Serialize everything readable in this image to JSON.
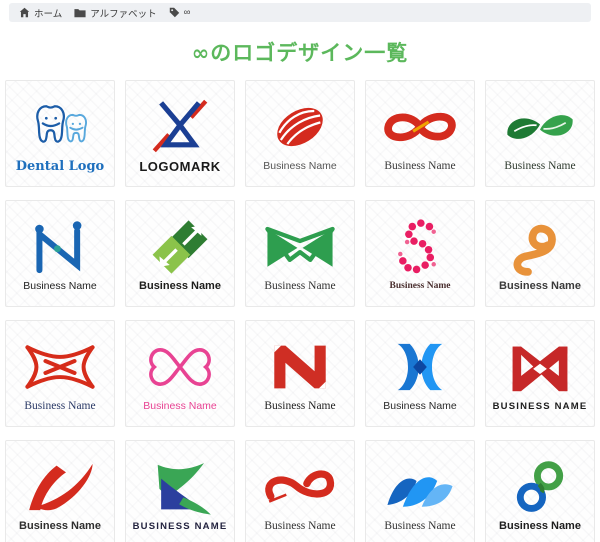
{
  "breadcrumb": {
    "items": [
      {
        "icon": "home-icon",
        "label": "ホーム"
      },
      {
        "icon": "folder-icon",
        "label": "アルファベット"
      },
      {
        "icon": "tag-icon",
        "label": "∞"
      }
    ]
  },
  "header": {
    "title": "∞のロゴデザイン一覧",
    "title_color": "#5cb85c"
  },
  "gallery": {
    "columns": 5,
    "rows": 4,
    "cards": [
      {
        "name": "Dental Logo",
        "icon": "dental-teeth-logo-icon",
        "text_color": "#1e6fbd",
        "logo_colors": [
          "#1c5da8",
          "#58a8dd"
        ]
      },
      {
        "name": "LOGOMARK",
        "icon": "hourglass-x-logo-icon",
        "text_color": "#1a1a1a",
        "logo_colors": [
          "#1b3f94",
          "#d42b1e"
        ]
      },
      {
        "name": "Business Name",
        "icon": "red-swirl-oval-logo-icon",
        "text_color": "#555555",
        "logo_colors": [
          "#d42b1e"
        ]
      },
      {
        "name": "Business Name",
        "icon": "red-infinity-ribbon-logo-icon",
        "text_color": "#3a3a3a",
        "logo_colors": [
          "#d42b1e",
          "#f0a500"
        ]
      },
      {
        "name": "Business Name",
        "icon": "green-leaf-infinity-logo-icon",
        "text_color": "#2f3b2f",
        "logo_colors": [
          "#1e7a34",
          "#35a24c"
        ]
      },
      {
        "name": "Business Name",
        "icon": "blue-n-nodes-logo-icon",
        "text_color": "#222222",
        "logo_colors": [
          "#1a66b3",
          "#2aa198"
        ]
      },
      {
        "name": "Business Name",
        "icon": "green-arrow-squares-logo-icon",
        "text_color": "#1d1d1b",
        "logo_colors": [
          "#2e7d32",
          "#8bc34a"
        ]
      },
      {
        "name": "Business Name",
        "icon": "green-bowtie-m-logo-icon",
        "text_color": "#333333",
        "logo_colors": [
          "#2e9e4f"
        ]
      },
      {
        "name": "Business Name",
        "icon": "pink-floral-s-logo-icon",
        "text_color": "#4a2f2f",
        "logo_colors": [
          "#e91e63",
          "#f06292"
        ]
      },
      {
        "name": "Business Name",
        "icon": "orange-p-spiral-logo-icon",
        "text_color": "#3a3a3a",
        "logo_colors": [
          "#e8923a"
        ]
      },
      {
        "name": "Business Name",
        "icon": "red-butterfly-knot-logo-icon",
        "text_color": "#2b3a67",
        "logo_colors": [
          "#d62c1a"
        ]
      },
      {
        "name": "Business Name",
        "icon": "pink-hearts-infinity-logo-icon",
        "text_color": "#e84393",
        "logo_colors": [
          "#e84393"
        ]
      },
      {
        "name": "Business Name",
        "icon": "red-angular-n-logo-icon",
        "text_color": "#1f1f1f",
        "logo_colors": [
          "#cf2e24"
        ]
      },
      {
        "name": "Business Name",
        "icon": "blue-3d-x-logo-icon",
        "text_color": "#2a2a2a",
        "logo_colors": [
          "#1976d2",
          "#2196f3",
          "#0d47a1"
        ]
      },
      {
        "name": "BUSINESS NAME",
        "icon": "red-m-arrows-logo-icon",
        "text_color": "#1d1d1d",
        "logo_colors": [
          "#c62828"
        ]
      },
      {
        "name": "Business Name",
        "icon": "red-swoosh-n-logo-icon",
        "text_color": "#2e2e2e",
        "logo_colors": [
          "#d42b1e"
        ]
      },
      {
        "name": "BUSINESS NAME",
        "icon": "green-blue-xz-logo-icon",
        "text_color": "#23233f",
        "logo_colors": [
          "#3aa655",
          "#2b3f9e"
        ]
      },
      {
        "name": "Business Name",
        "icon": "red-infinity-swoosh-logo-icon",
        "text_color": "#333333",
        "logo_colors": [
          "#d42b1e"
        ]
      },
      {
        "name": "Business Name",
        "icon": "blue-wave-n-logo-icon",
        "text_color": "#333333",
        "logo_colors": [
          "#1565c0",
          "#2196f3",
          "#64b5f6"
        ]
      },
      {
        "name": "Business Name",
        "icon": "blue-green-ribbon-s-logo-icon",
        "text_color": "#1d1d1d",
        "logo_colors": [
          "#43a047",
          "#1565c0"
        ]
      }
    ]
  }
}
